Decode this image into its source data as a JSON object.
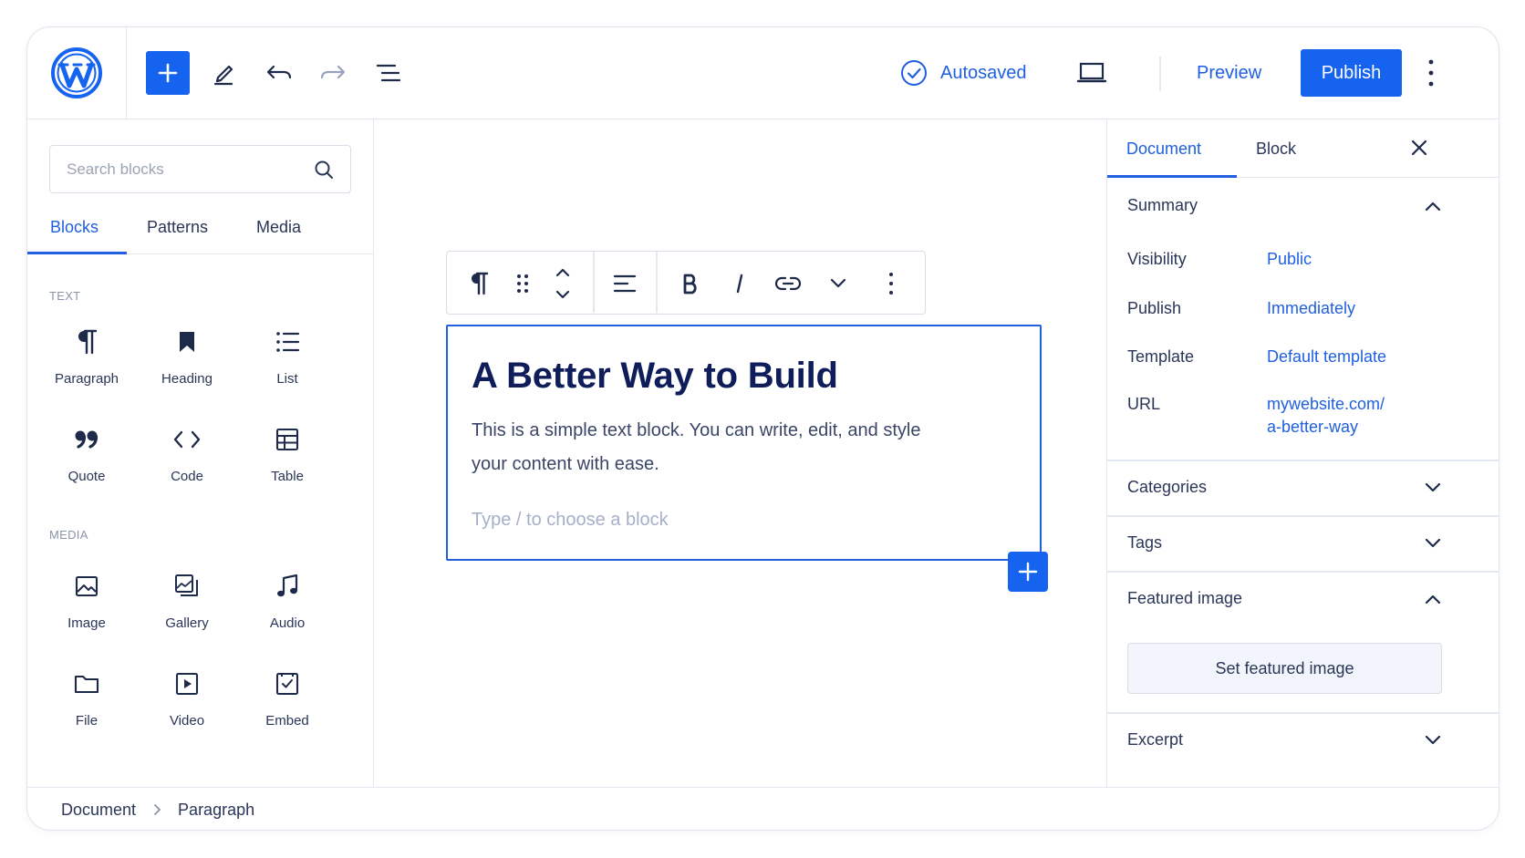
{
  "header": {
    "autosaved_label": "Autosaved",
    "preview_label": "Preview",
    "publish_label": "Publish"
  },
  "inserter": {
    "search_placeholder": "Search blocks",
    "tabs": [
      "Blocks",
      "Patterns",
      "Media"
    ],
    "active_tab": "Blocks",
    "sections": [
      {
        "label": "TEXT",
        "items": [
          {
            "label": "Paragraph",
            "icon": "paragraph-icon"
          },
          {
            "label": "Heading",
            "icon": "bookmark-icon"
          },
          {
            "label": "List",
            "icon": "list-icon"
          },
          {
            "label": "Quote",
            "icon": "quote-icon"
          },
          {
            "label": "Code",
            "icon": "code-icon"
          },
          {
            "label": "Table",
            "icon": "table-icon"
          }
        ]
      },
      {
        "label": "MEDIA",
        "items": [
          {
            "label": "Image",
            "icon": "image-icon"
          },
          {
            "label": "Gallery",
            "icon": "gallery-icon"
          },
          {
            "label": "Audio",
            "icon": "music-note-icon"
          },
          {
            "label": "File",
            "icon": "folder-icon"
          },
          {
            "label": "Video",
            "icon": "video-icon"
          },
          {
            "label": "Embed",
            "icon": "embed-icon"
          }
        ]
      }
    ]
  },
  "editor": {
    "title": "A Better Way to Build",
    "body": "This is a simple text block. You can write, edit, and style your content with ease.",
    "placeholder": "Type / to choose a block"
  },
  "settings": {
    "tabs": [
      "Document",
      "Block"
    ],
    "active_tab": "Document",
    "summary": {
      "heading": "Summary",
      "rows": [
        {
          "key": "Visibility",
          "value": "Public"
        },
        {
          "key": "Publish",
          "value": "Immediately"
        },
        {
          "key": "Template",
          "value": "Default template"
        },
        {
          "key": "URL",
          "value": "mywebsite.com/",
          "value2": "a-better-way"
        }
      ]
    },
    "categories": "Categories",
    "tags": "Tags",
    "featured_image": {
      "heading": "Featured image",
      "button": "Set featured image"
    },
    "excerpt": "Excerpt"
  },
  "footer": {
    "breadcrumb": [
      "Document",
      "Paragraph"
    ]
  },
  "colors": {
    "accent": "#1663f0",
    "link": "#1f5fe0",
    "title": "#0f1d5b",
    "border": "#e3e7ef"
  }
}
